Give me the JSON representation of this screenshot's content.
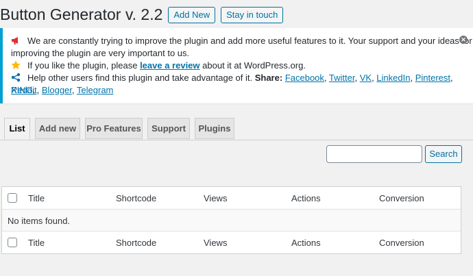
{
  "header": {
    "title": "Button Generator v. 2.2",
    "add_new": "Add New",
    "stay_in_touch": "Stay in touch"
  },
  "notice": {
    "line1": "We are constantly trying to improve the plugin and add more useful features to it. Your support and your ideas for",
    "line1b": "improving the plugin are very important to us.",
    "line2_pre": "If you like the plugin, please ",
    "line2_link": "leave a review",
    "line2_post": " about it at WordPress.org.",
    "line3_pre": "Help other users find this plugin and take advantage of it. ",
    "line3_bold": "Share:",
    "share_links": [
      "Facebook",
      "Twitter",
      "VK",
      "LinkedIn",
      "Pinterest",
      "XING",
      "Reddit",
      "Blogger",
      "Telegram"
    ],
    "icons": [
      "megaphone-icon",
      "star-icon",
      "share-icon",
      "close-icon"
    ],
    "accent_color": "#00a0d2"
  },
  "tabs": [
    "List",
    "Add new",
    "Pro Features",
    "Support",
    "Plugins"
  ],
  "active_tab": "List",
  "search": {
    "button": "Search",
    "value": ""
  },
  "table": {
    "columns": [
      "Title",
      "Shortcode",
      "Views",
      "Actions",
      "Conversion"
    ],
    "empty_message": "No items found."
  }
}
